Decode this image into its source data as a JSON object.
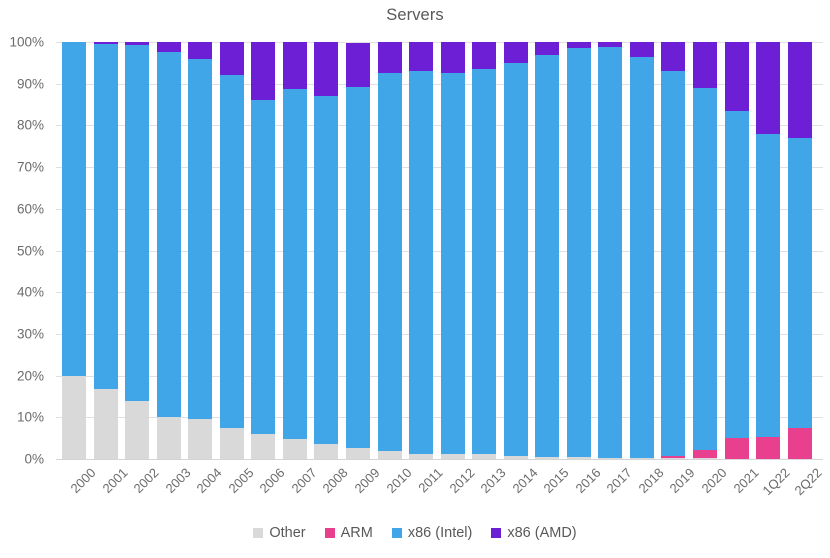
{
  "chart_data": {
    "type": "bar",
    "title": "Servers",
    "subtitle": "",
    "xlabel": "",
    "ylabel": "",
    "stacked": true,
    "stack_mode": "percent",
    "grid": true,
    "legend_position": "bottom",
    "ylim": [
      0,
      100
    ],
    "ytick_labels": [
      "0%",
      "10%",
      "20%",
      "30%",
      "40%",
      "50%",
      "60%",
      "70%",
      "80%",
      "90%",
      "100%"
    ],
    "ytick_values": [
      0,
      10,
      20,
      30,
      40,
      50,
      60,
      70,
      80,
      90,
      100
    ],
    "categories": [
      "2000",
      "2001",
      "2002",
      "2003",
      "2004",
      "2005",
      "2006",
      "2007",
      "2008",
      "2009",
      "2010",
      "2011",
      "2012",
      "2013",
      "2014",
      "2015",
      "2016",
      "2017",
      "2018",
      "2019",
      "2020",
      "2021",
      "1Q22",
      "2Q22"
    ],
    "series": [
      {
        "name": "Other",
        "color": "#d9d9d9",
        "values": [
          20.0,
          16.8,
          14.0,
          10.0,
          9.5,
          7.5,
          6.0,
          4.8,
          3.7,
          2.6,
          1.9,
          1.2,
          1.3,
          1.2,
          0.7,
          0.5,
          0.4,
          0.3,
          0.3,
          0.2,
          0.2,
          0.1,
          0.1,
          0.1
        ]
      },
      {
        "name": "ARM",
        "color": "#e8408f",
        "values": [
          0,
          0,
          0,
          0,
          0,
          0,
          0,
          0,
          0,
          0,
          0,
          0,
          0,
          0,
          0,
          0,
          0,
          0,
          0,
          0.6,
          2.0,
          4.9,
          5.2,
          7.4
        ]
      },
      {
        "name": "x86 (Intel)",
        "color": "#41a6e8",
        "values": [
          80.0,
          82.7,
          85.4,
          87.5,
          86.5,
          84.5,
          80.0,
          83.9,
          83.3,
          86.7,
          90.6,
          91.8,
          91.2,
          92.3,
          94.3,
          96.5,
          98.1,
          98.4,
          96.2,
          92.2,
          86.8,
          78.5,
          72.7,
          69.5
        ]
      },
      {
        "name": "x86 (AMD)",
        "color": "#6c1fd4",
        "values": [
          0.0,
          0.5,
          0.6,
          2.5,
          4.0,
          8.0,
          14.0,
          11.3,
          13.0,
          10.5,
          7.5,
          7.0,
          7.5,
          6.5,
          5.0,
          3.0,
          1.5,
          1.3,
          3.5,
          7.0,
          11.0,
          16.5,
          22.0,
          23.0
        ]
      }
    ]
  },
  "legend": {
    "items": [
      {
        "label": "Other",
        "color": "#d9d9d9"
      },
      {
        "label": "ARM",
        "color": "#e8408f"
      },
      {
        "label": "x86 (Intel)",
        "color": "#41a6e8"
      },
      {
        "label": "x86 (AMD)",
        "color": "#6c1fd4"
      }
    ]
  }
}
